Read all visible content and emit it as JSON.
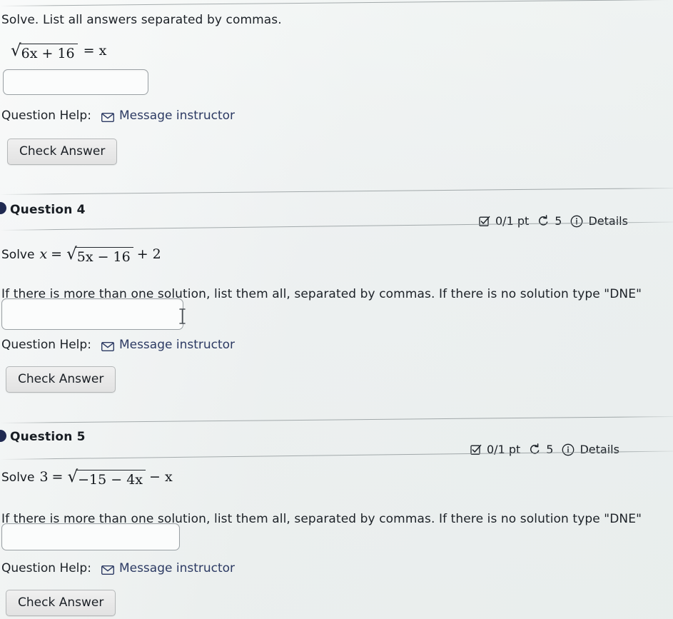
{
  "page": {
    "background_color": "#eef1f0",
    "text_color": "#1d2228",
    "link_color": "#2c3a63",
    "bullet_color": "#202a52"
  },
  "questions": [
    {
      "id": "q3-partial",
      "prompt": "Solve. List all answers separated by commas.",
      "equation": {
        "lead": "",
        "left_radical_body": "6x + 16",
        "after_radical": "= x",
        "plain": "√(6x + 16) = x"
      },
      "answer_input": {
        "value": "",
        "placeholder": ""
      },
      "help_label": "Question Help:",
      "message_link": "Message instructor",
      "message_icon": "envelope-icon",
      "check_button": "Check Answer"
    },
    {
      "id": "q4",
      "title": "Question 4",
      "meta": {
        "score_icon": "checkbox-checked-icon",
        "score": "0/1 pt",
        "attempts_icon": "rotate-counterclockwise-icon",
        "attempts": "5",
        "info_icon": "info-circle-icon",
        "details": "Details"
      },
      "equation": {
        "lead": "Solve",
        "lhs": "x",
        "equals": "=",
        "radical_body": "5x − 16",
        "after_radical": "+ 2",
        "plain": "Solve x = √(5x − 16) + 2"
      },
      "instruction": "If there is more than one solution, list them all, separated by commas. If there is no solution type \"DNE\"",
      "answer_input": {
        "value": "",
        "placeholder": ""
      },
      "help_label": "Question Help:",
      "message_link": "Message instructor",
      "message_icon": "envelope-icon",
      "check_button": "Check Answer"
    },
    {
      "id": "q5",
      "title": "Question 5",
      "meta": {
        "score_icon": "checkbox-checked-icon",
        "score": "0/1 pt",
        "attempts_icon": "rotate-counterclockwise-icon",
        "attempts": "5",
        "info_icon": "info-circle-icon",
        "details": "Details"
      },
      "equation": {
        "lead": "Solve",
        "lhs": "3",
        "equals": "=",
        "radical_body": "−15 − 4x",
        "after_radical": "− x",
        "plain": "Solve 3 = √(−15 − 4x) − x"
      },
      "instruction": "If there is more than one solution, list them all, separated by commas. If there is no solution type \"DNE\"",
      "answer_input": {
        "value": "",
        "placeholder": ""
      },
      "help_label": "Question Help:",
      "message_link": "Message instructor",
      "message_icon": "envelope-icon",
      "check_button": "Check Answer"
    }
  ],
  "cursor": {
    "type": "text-ibeam"
  }
}
